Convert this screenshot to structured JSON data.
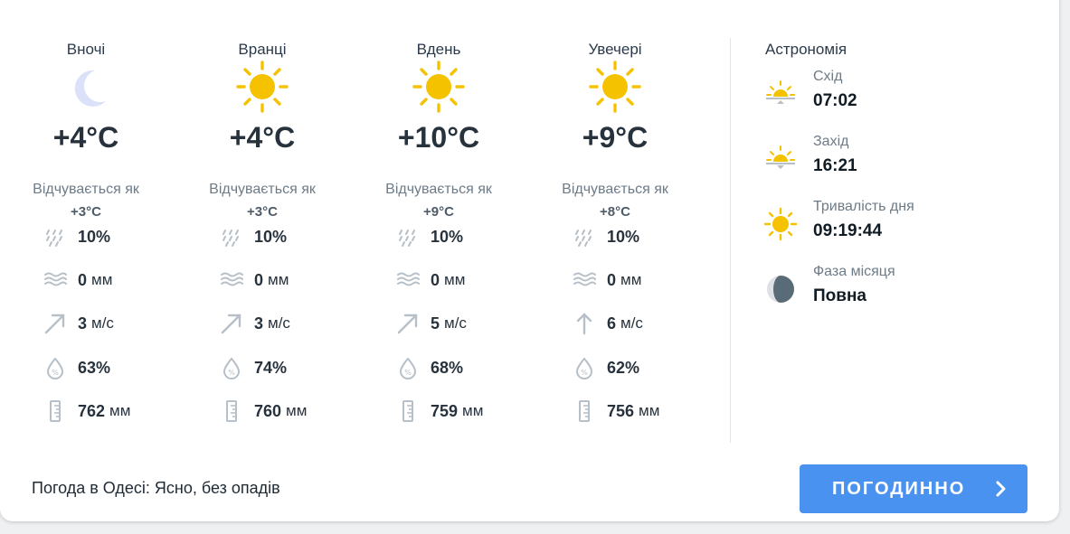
{
  "periods": [
    {
      "title": "Вночі",
      "icon": "moon-icon",
      "temp": "+4°C",
      "feels_label": "Відчувається як",
      "feels": "+3°C",
      "precip_chance": "10%",
      "precip_amount": "0",
      "precip_unit": "мм",
      "wind_speed": "3",
      "wind_unit": "м/с",
      "wind_dir": "south-west",
      "humidity": "63%",
      "pressure": "762",
      "pressure_unit": "мм"
    },
    {
      "title": "Вранці",
      "icon": "sun-icon",
      "temp": "+4°C",
      "feels_label": "Відчувається як",
      "feels": "+3°C",
      "precip_chance": "10%",
      "precip_amount": "0",
      "precip_unit": "мм",
      "wind_speed": "3",
      "wind_unit": "м/с",
      "wind_dir": "south-west",
      "humidity": "74%",
      "pressure": "760",
      "pressure_unit": "мм"
    },
    {
      "title": "Вдень",
      "icon": "sun-icon",
      "temp": "+10°C",
      "feels_label": "Відчувається як",
      "feels": "+9°C",
      "precip_chance": "10%",
      "precip_amount": "0",
      "precip_unit": "мм",
      "wind_speed": "5",
      "wind_unit": "м/с",
      "wind_dir": "south-west",
      "humidity": "68%",
      "pressure": "759",
      "pressure_unit": "мм"
    },
    {
      "title": "Увечері",
      "icon": "sun-icon",
      "temp": "+9°C",
      "feels_label": "Відчувається як",
      "feels": "+8°C",
      "precip_chance": "10%",
      "precip_amount": "0",
      "precip_unit": "мм",
      "wind_speed": "6",
      "wind_unit": "м/с",
      "wind_dir": "south",
      "humidity": "62%",
      "pressure": "756",
      "pressure_unit": "мм"
    }
  ],
  "astronomy": {
    "title": "Астрономія",
    "sunrise_label": "Схід",
    "sunrise": "07:02",
    "sunset_label": "Захід",
    "sunset": "16:21",
    "daylength_label": "Тривалість дня",
    "daylength": "09:19:44",
    "moon_label": "Фаза місяця",
    "moon": "Повна"
  },
  "footer": {
    "summary": "Погода в Одесі: Ясно, без опадів",
    "hourly_button": "ПОГОДИННО"
  },
  "colors": {
    "accent": "#4a92f0",
    "sun": "#f5c200",
    "moon": "#d9def8",
    "icon_gray": "#b7c0c8"
  }
}
